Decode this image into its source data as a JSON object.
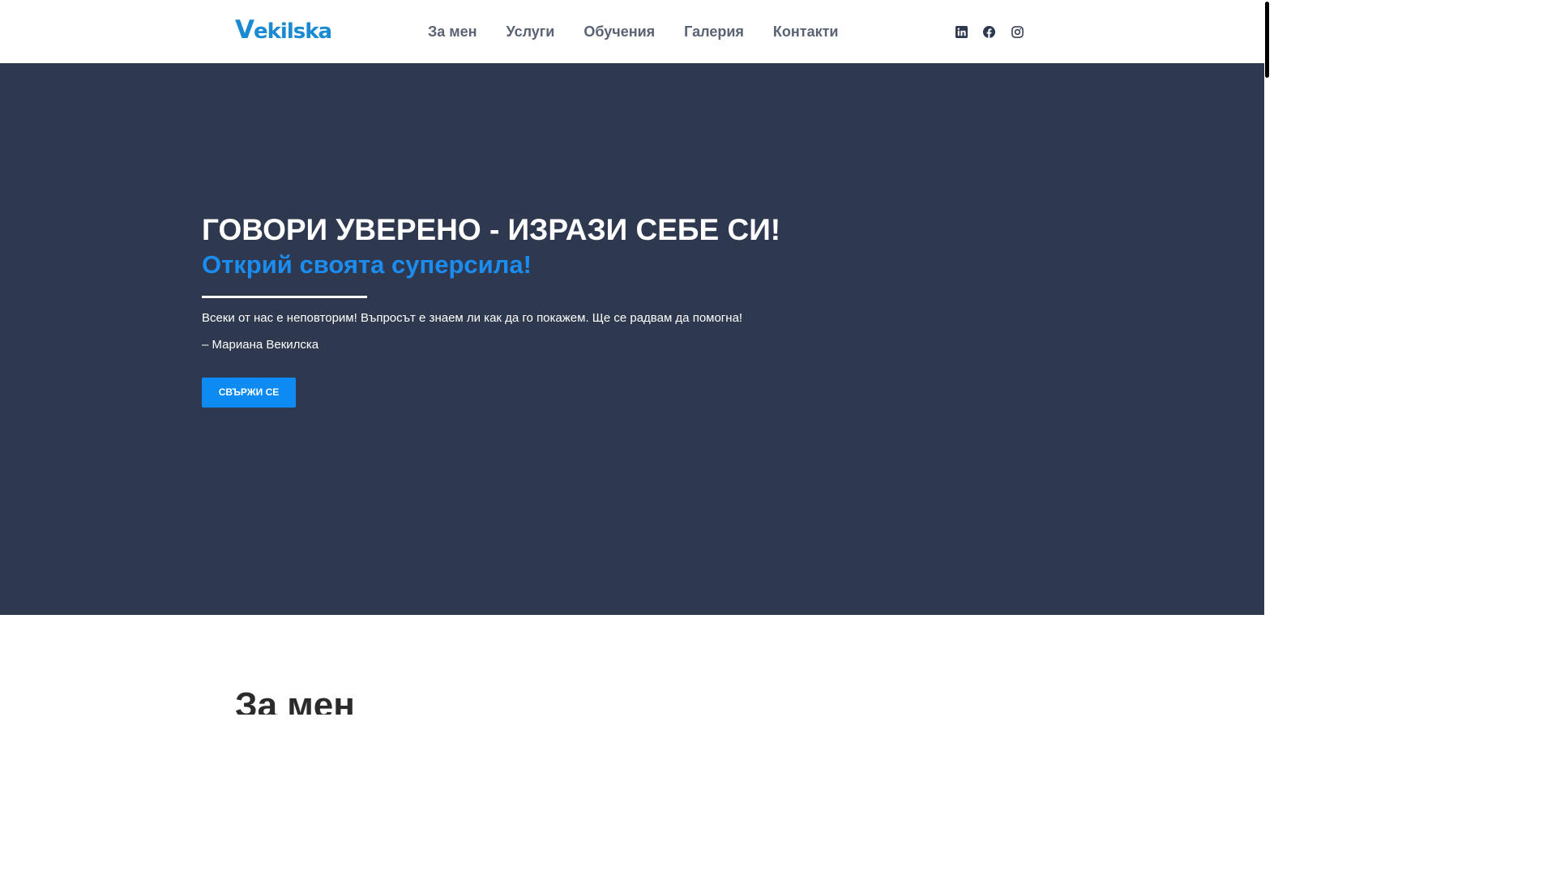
{
  "header": {
    "logo_text_first": "V",
    "logo_text_rest": "ekilska",
    "nav": [
      {
        "label": "За мен"
      },
      {
        "label": "Услуги"
      },
      {
        "label": "Обучения"
      },
      {
        "label": "Галерия"
      },
      {
        "label": "Контакти"
      }
    ],
    "social": [
      {
        "icon": "linkedin-icon"
      },
      {
        "icon": "facebook-icon"
      },
      {
        "icon": "instagram-icon"
      }
    ]
  },
  "hero": {
    "title": "ГОВОРИ УВЕРЕНО - ИЗРАЗИ СЕБЕ СИ!",
    "subtitle": "Открий своята суперсила!",
    "text": "Всеки от нас е неповторим! Въпросът е знаем ли как да го покажем. Ще се радвам да помогна!",
    "author": "– Мариана Векилска",
    "button_label": "СВЪРЖИ СЕ"
  },
  "about": {
    "heading": "За мен"
  },
  "colors": {
    "hero_background": "#2e384e",
    "accent": "#1b8cf0",
    "button": "#0d8bf2",
    "nav_text": "#5a6373",
    "logo": "#1a8ad3",
    "social_icon": "#2e384e"
  }
}
